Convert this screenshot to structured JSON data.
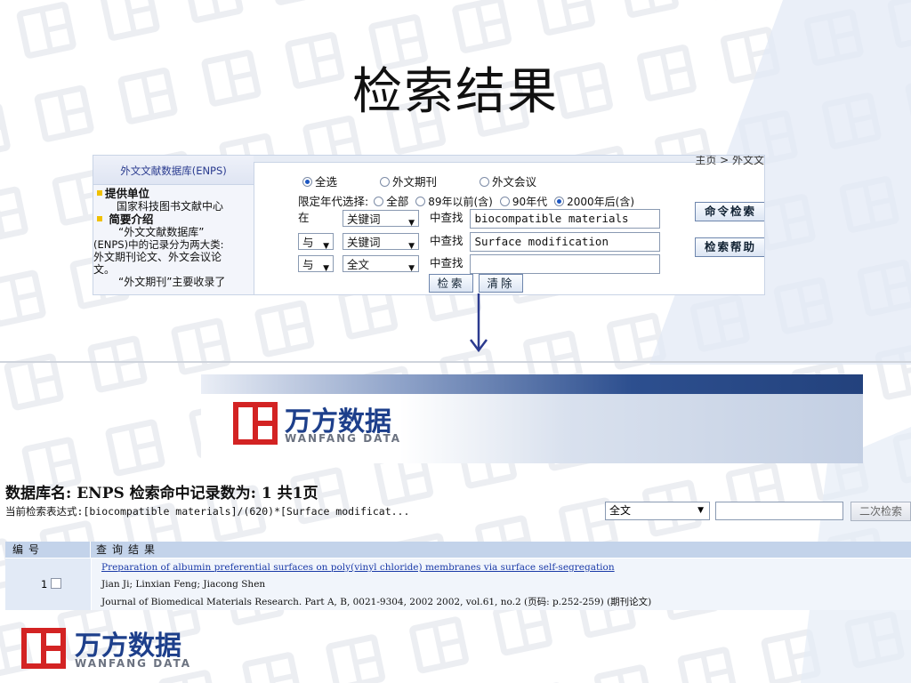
{
  "slide": {
    "title": "检索结果"
  },
  "search_panel": {
    "sidebar_title": "外文文献数据库(ENPS)",
    "provider_heading": "提供单位",
    "provider_name": "国家科技图书文献中心",
    "intro_heading": "简要介绍",
    "intro_lines": [
      "“外文文献数据库”",
      "(ENPS)中的记录分为两大类:",
      "外文期刊论文、外文会议论",
      "文。",
      "“外文期刊”主要收录了"
    ],
    "breadcrumb": "主页 > 外文文",
    "type_options": [
      "全选",
      "外文期刊",
      "外文会议"
    ],
    "type_selected": "全选",
    "year_label": "限定年代选择:",
    "year_options": [
      "全部",
      "89年以前(含)",
      "90年代",
      "2000年后(含)"
    ],
    "year_selected": "2000年后(含)",
    "rows": [
      {
        "op": "在",
        "field": "关键词",
        "find_label": "中查找",
        "value": "biocompatible materials"
      },
      {
        "op": "与",
        "field": "关键词",
        "find_label": "中查找",
        "value": "Surface modification"
      },
      {
        "op": "与",
        "field": "全文",
        "find_label": "中查找",
        "value": ""
      }
    ],
    "search_button": "检索",
    "clear_button": "清除",
    "command_search_button": "命令检索",
    "search_help_button": "检索帮助"
  },
  "brand": {
    "name": "万方数据",
    "name_en": "WANFANG DATA"
  },
  "results": {
    "heading": "数据库名: ENPS 检索命中记录数为: 1 共1页",
    "expression_label": "当前检索表达式:",
    "expression": "[biocompatible materials]/(620)*[Surface modificat...",
    "secondary_field": "全文",
    "secondary_search_button": "二次检索",
    "columns": [
      "编号",
      "查询结果"
    ],
    "items": [
      {
        "number": "1",
        "title": "Preparation of albumin preferential surfaces on poly(vinyl chloride) membranes via surface self-segregation",
        "authors": "Jian Ji; Linxian Feng; Jiacong Shen",
        "source": "Journal of Biomedical Materials Research. Part A, B, 0021-9304, 2002 2002, vol.61, no.2 (页码: p.252-259) (期刊论文)"
      }
    ]
  },
  "colors": {
    "accent_blue": "#1d3f8b",
    "logo_red": "#d32323",
    "arrow": "#2c3b8f"
  }
}
